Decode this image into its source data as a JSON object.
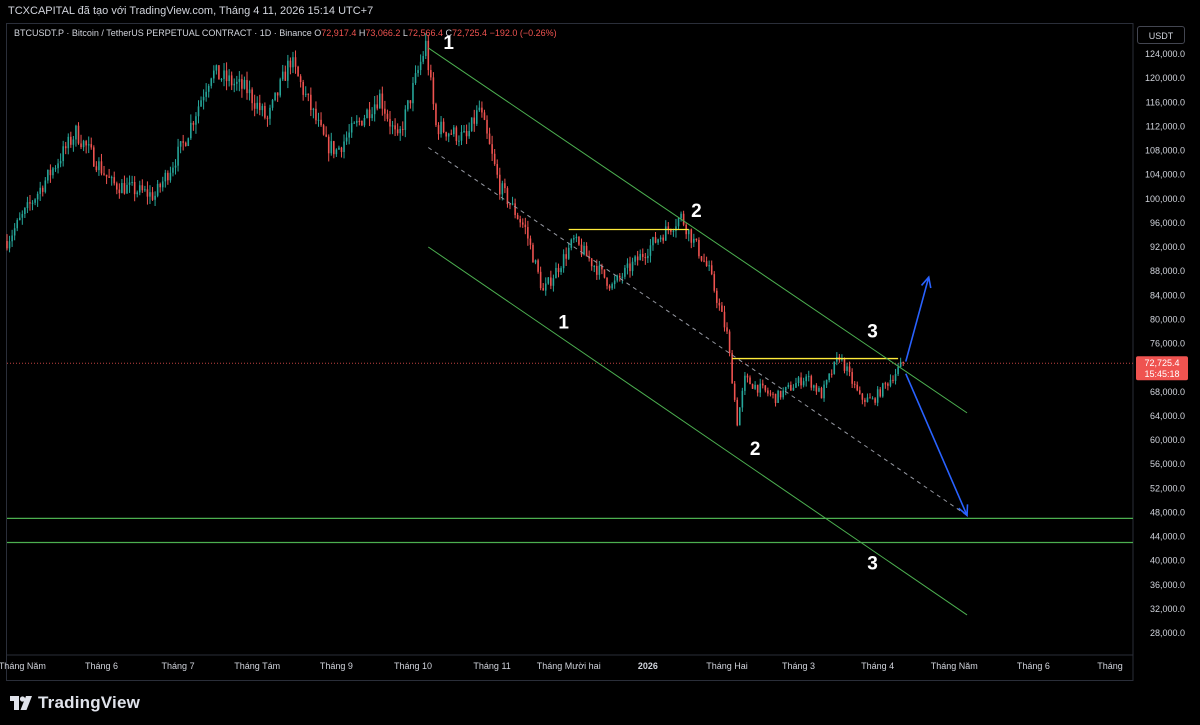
{
  "header": {
    "title": "TCXCAPITAL đã tạo với TradingView.com, Tháng 4 11, 2026 15:14 UTC+7"
  },
  "legend": {
    "symbol": "BTCUSDT.P · Bitcoin / TetherUS PERPETUAL CONTRACT · 1D · Binance",
    "o_label": "O",
    "o_value": "72,917.4",
    "h_label": "H",
    "h_value": "73,066.2",
    "l_label": "L",
    "l_value": "72,566.4",
    "c_label": "C",
    "c_value": "72,725.4",
    "change": "−192.0 (−0.26%)"
  },
  "toolbar": {
    "currency": "USDT"
  },
  "price_tag": {
    "price": "72,725.4",
    "countdown": "15:45:18"
  },
  "branding": {
    "logo_text": "TradingView"
  },
  "colors": {
    "up": "#26a69a",
    "down": "#ef5350",
    "channel": "#4caf50",
    "level": "#ffeb3b",
    "arrow": "#2962ff",
    "text": "#d1d4dc"
  },
  "chart_data": {
    "type": "candlestick",
    "y_axis": {
      "min": 25000,
      "max": 128000,
      "ticks": [
        28000,
        32000,
        36000,
        40000,
        44000,
        48000,
        52000,
        56000,
        60000,
        64000,
        68000,
        72000,
        76000,
        80000,
        84000,
        88000,
        92000,
        96000,
        100000,
        104000,
        108000,
        112000,
        116000,
        120000,
        124000
      ],
      "tick_labels": [
        "28,000.0",
        "32,000.0",
        "36,000.0",
        "40,000.0",
        "44,000.0",
        "48,000.0",
        "52,000.0",
        "56,000.0",
        "60,000.0",
        "64,000.0",
        "68,000.0",
        "72,000.0",
        "76,000.0",
        "80,000.0",
        "84,000.0",
        "88,000.0",
        "92,000.0",
        "96,000.0",
        "100,000.0",
        "104,000.0",
        "108,000.0",
        "112,000.0",
        "116,000.0",
        "120,000.0",
        "124,000.0"
      ]
    },
    "x_axis": {
      "start": "2025-04-25",
      "end": "2026-07-10",
      "ticks": [
        {
          "date": "2025-05-01",
          "label": "Tháng Năm"
        },
        {
          "date": "2025-06-01",
          "label": "Tháng 6"
        },
        {
          "date": "2025-07-01",
          "label": "Tháng 7"
        },
        {
          "date": "2025-08-01",
          "label": "Tháng Tám"
        },
        {
          "date": "2025-09-01",
          "label": "Tháng 9"
        },
        {
          "date": "2025-10-01",
          "label": "Tháng 10"
        },
        {
          "date": "2025-11-01",
          "label": "Tháng 11"
        },
        {
          "date": "2025-12-01",
          "label": "Tháng Mười hai"
        },
        {
          "date": "2026-01-01",
          "label": "2026"
        },
        {
          "date": "2026-02-01",
          "label": "Tháng Hai"
        },
        {
          "date": "2026-03-01",
          "label": "Tháng 3"
        },
        {
          "date": "2026-04-01",
          "label": "Tháng 4"
        },
        {
          "date": "2026-05-01",
          "label": "Tháng Năm"
        },
        {
          "date": "2026-06-01",
          "label": "Tháng 6"
        },
        {
          "date": "2026-07-01",
          "label": "Tháng"
        }
      ]
    },
    "price_anchors": [
      [
        "2025-04-25",
        93000
      ],
      [
        "2025-05-10",
        103000
      ],
      [
        "2025-05-22",
        111000
      ],
      [
        "2025-06-05",
        102500
      ],
      [
        "2025-06-22",
        100500
      ],
      [
        "2025-07-03",
        109000
      ],
      [
        "2025-07-14",
        121000
      ],
      [
        "2025-07-28",
        118000
      ],
      [
        "2025-08-05",
        113000
      ],
      [
        "2025-08-14",
        123000
      ],
      [
        "2025-08-28",
        109000
      ],
      [
        "2025-09-01",
        108000
      ],
      [
        "2025-09-18",
        117000
      ],
      [
        "2025-09-25",
        109500
      ],
      [
        "2025-10-06",
        125500
      ],
      [
        "2025-10-10",
        112000
      ],
      [
        "2025-10-22",
        110000
      ],
      [
        "2025-10-27",
        115000
      ],
      [
        "2025-11-04",
        102000
      ],
      [
        "2025-11-14",
        95000
      ],
      [
        "2025-11-21",
        84500
      ],
      [
        "2025-12-03",
        93000
      ],
      [
        "2025-12-18",
        85500
      ],
      [
        "2026-01-05",
        93500
      ],
      [
        "2026-01-14",
        97000
      ],
      [
        "2026-01-25",
        88000
      ],
      [
        "2026-02-01",
        77500
      ],
      [
        "2026-02-05",
        63000
      ],
      [
        "2026-02-08",
        70000
      ],
      [
        "2026-02-20",
        67000
      ],
      [
        "2026-03-04",
        70500
      ],
      [
        "2026-03-10",
        67500
      ],
      [
        "2026-03-17",
        74000
      ],
      [
        "2026-03-25",
        67000
      ],
      [
        "2026-03-30",
        66500
      ],
      [
        "2026-04-11",
        72725
      ]
    ],
    "last_price": 72725.4,
    "horizontal_levels": [
      {
        "price": 94900,
        "from": "2025-12-01",
        "to": "2026-01-17",
        "color": "yellow"
      },
      {
        "price": 73500,
        "from": "2026-02-03",
        "to": "2026-04-09",
        "color": "yellow"
      },
      {
        "price": 47000,
        "from": "2025-04-25",
        "to": "2026-07-10",
        "color": "green"
      },
      {
        "price": 43000,
        "from": "2025-04-25",
        "to": "2026-07-10",
        "color": "green"
      }
    ],
    "channel": {
      "upper": [
        [
          "2025-10-07",
          125000
        ],
        [
          "2026-05-06",
          64500
        ]
      ],
      "lower": [
        [
          "2025-10-07",
          92000
        ],
        [
          "2026-05-06",
          31000
        ]
      ],
      "mid": [
        [
          "2025-10-07",
          108500
        ],
        [
          "2026-05-06",
          47500
        ]
      ]
    },
    "arrows": [
      {
        "from": [
          "2026-04-12",
          73000
        ],
        "to": [
          "2026-04-21",
          87000
        ]
      },
      {
        "from": [
          "2026-04-12",
          71000
        ],
        "to": [
          "2026-05-06",
          47500
        ]
      }
    ],
    "wave_labels": [
      {
        "text": "1",
        "date": "2025-10-15",
        "price": 124800
      },
      {
        "text": "1",
        "date": "2025-11-29",
        "price": 78500
      },
      {
        "text": "2",
        "date": "2026-01-20",
        "price": 97000
      },
      {
        "text": "2",
        "date": "2026-02-12",
        "price": 57500
      },
      {
        "text": "3",
        "date": "2026-03-30",
        "price": 77000
      },
      {
        "text": "3",
        "date": "2026-03-30",
        "price": 38500
      }
    ]
  }
}
